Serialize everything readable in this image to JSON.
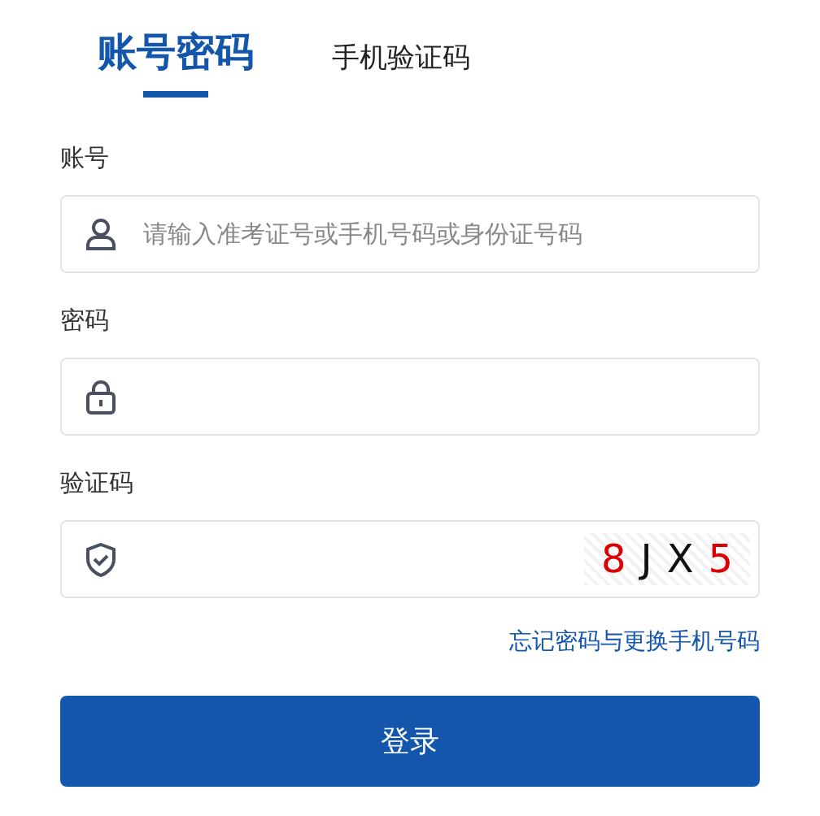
{
  "tabs": [
    {
      "label": "账号密码",
      "selected": true
    },
    {
      "label": "手机验证码",
      "selected": false
    }
  ],
  "fields": [
    {
      "label": "账号",
      "kind": "user",
      "placeholder": "请输入准考证号或手机号码或身份证号码"
    },
    {
      "label": "密码",
      "kind": "lock"
    },
    {
      "label": "验证码",
      "kind": "shield",
      "captcha": [
        {
          "char": "8",
          "color": "#dd0000"
        },
        {
          "char": "J",
          "color": "#111111"
        },
        {
          "char": "X",
          "color": "#111111"
        },
        {
          "char": "5",
          "color": "#dd0000"
        }
      ]
    }
  ],
  "link": "忘记密码与更换手机号码",
  "submit": "登录"
}
